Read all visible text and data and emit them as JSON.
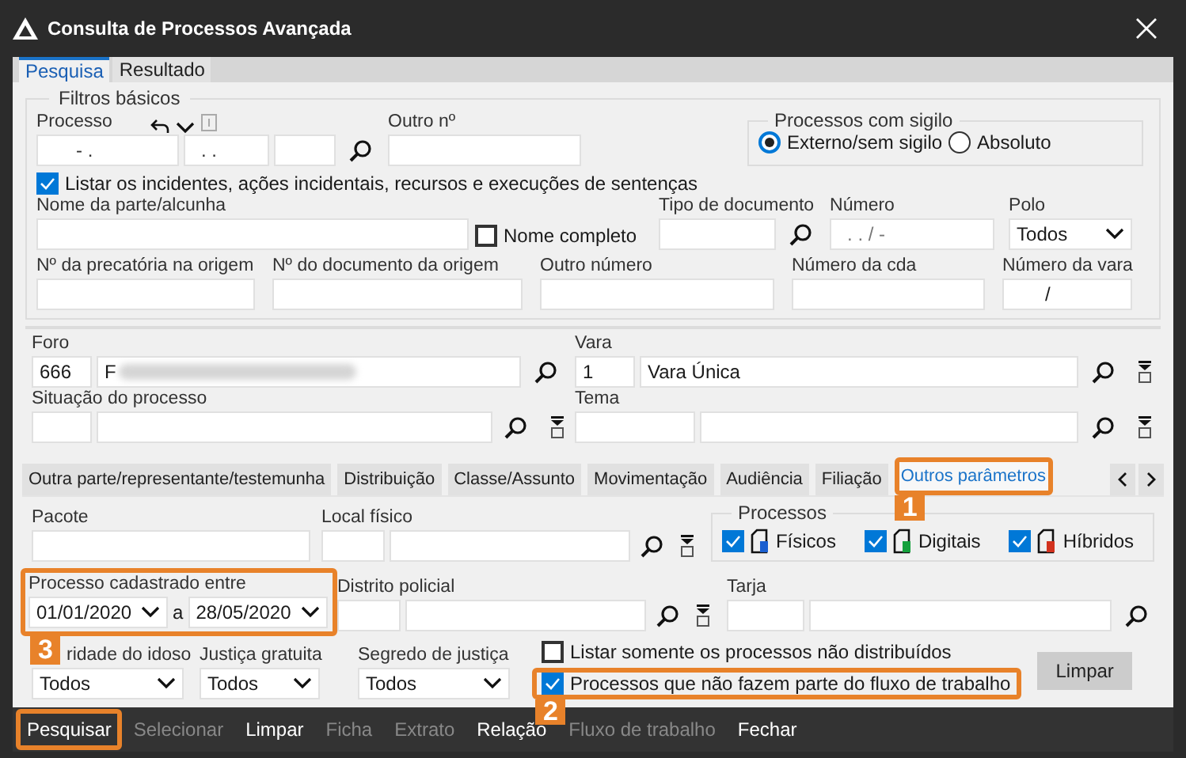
{
  "window": {
    "title": "Consulta de Processos Avançada"
  },
  "tabs": [
    {
      "label": "Pesquisa",
      "selected": true
    },
    {
      "label": "Resultado",
      "selected": false
    }
  ],
  "basic_filters": {
    "title": "Filtros básicos",
    "processo": {
      "label": "Processo",
      "parts": [
        "- .",
        ". ."
      ]
    },
    "outro_numero": {
      "label": "Outro nº"
    },
    "sigilo": {
      "title": "Processos com sigilo",
      "options": [
        {
          "label": "Externo/sem sigilo",
          "selected": true
        },
        {
          "label": "Absoluto",
          "selected": false
        }
      ]
    },
    "list_incidents": {
      "label": "Listar os incidentes, ações incidentais, recursos e execuções de sentenças",
      "checked": true
    },
    "nome_parte": {
      "label": "Nome da parte/alcunha"
    },
    "nome_completo": {
      "label": "Nome completo",
      "checked": false
    },
    "tipo_documento": {
      "label": "Tipo de documento"
    },
    "numero": {
      "label": "Número",
      "placeholder": ". . / -"
    },
    "polo": {
      "label": "Polo",
      "value": "Todos"
    },
    "other_numbers": [
      {
        "label": "Nº da precatória na origem"
      },
      {
        "label": "Nº do documento da origem"
      },
      {
        "label": "Outro número"
      },
      {
        "label": "Número da cda"
      },
      {
        "label": "Número da vara",
        "value": "/"
      }
    ]
  },
  "foro": {
    "label": "Foro",
    "code": "666",
    "name": "F"
  },
  "vara": {
    "label": "Vara",
    "code": "1",
    "name": "Vara Única"
  },
  "situacao": {
    "label": "Situação do processo"
  },
  "tema": {
    "label": "Tema"
  },
  "section_tabs": [
    {
      "label": "Outra parte/representante/testemunha",
      "selected": false
    },
    {
      "label": "Distribuição",
      "selected": false
    },
    {
      "label": "Classe/Assunto",
      "selected": false
    },
    {
      "label": "Movimentação",
      "selected": false
    },
    {
      "label": "Audiência",
      "selected": false
    },
    {
      "label": "Filiação",
      "selected": false
    },
    {
      "label": "Outros parâmetros",
      "selected": true,
      "highlighted": true,
      "callout": "1"
    }
  ],
  "other_params": {
    "pacote": {
      "label": "Pacote"
    },
    "local_fisico": {
      "label": "Local físico"
    },
    "processos": {
      "title": "Processos",
      "items": [
        {
          "label": "Físicos",
          "checked": true,
          "color": "#1a5fd0"
        },
        {
          "label": "Digitais",
          "checked": true,
          "color": "#14a03c"
        },
        {
          "label": "Híbridos",
          "checked": true,
          "color": "#d2321e"
        }
      ]
    },
    "cadastrado": {
      "label": "Processo cadastrado entre",
      "from": "01/01/2020",
      "joiner": "a",
      "to": "28/05/2020",
      "highlighted": true,
      "callout": "3"
    },
    "distrito": {
      "label": "Distrito policial"
    },
    "tarja": {
      "label": "Tarja"
    },
    "selects": [
      {
        "label": "ridade do idoso",
        "value": "Todos"
      },
      {
        "label": "Justiça gratuita",
        "value": "Todos"
      },
      {
        "label": "Segredo de justiça",
        "value": "Todos"
      }
    ],
    "flags": [
      {
        "label": "Listar somente os processos não distribuídos",
        "checked": false,
        "highlighted": false
      },
      {
        "label": "Processos que não fazem parte do fluxo de trabalho",
        "checked": true,
        "highlighted": true,
        "callout": "2"
      }
    ],
    "clear_button": "Limpar"
  },
  "toolbar": [
    {
      "label": "Pesquisar",
      "disabled": false,
      "highlighted": true
    },
    {
      "label": "Selecionar",
      "disabled": true,
      "highlighted": false
    },
    {
      "label": "Limpar",
      "disabled": false,
      "highlighted": false
    },
    {
      "label": "Ficha",
      "disabled": true,
      "highlighted": false
    },
    {
      "label": "Extrato",
      "disabled": true,
      "highlighted": false
    },
    {
      "label": "Relação",
      "disabled": false,
      "highlighted": false
    },
    {
      "label": "Fluxo de trabalho",
      "disabled": true,
      "highlighted": false
    },
    {
      "label": "Fechar",
      "disabled": false,
      "highlighted": false
    }
  ]
}
